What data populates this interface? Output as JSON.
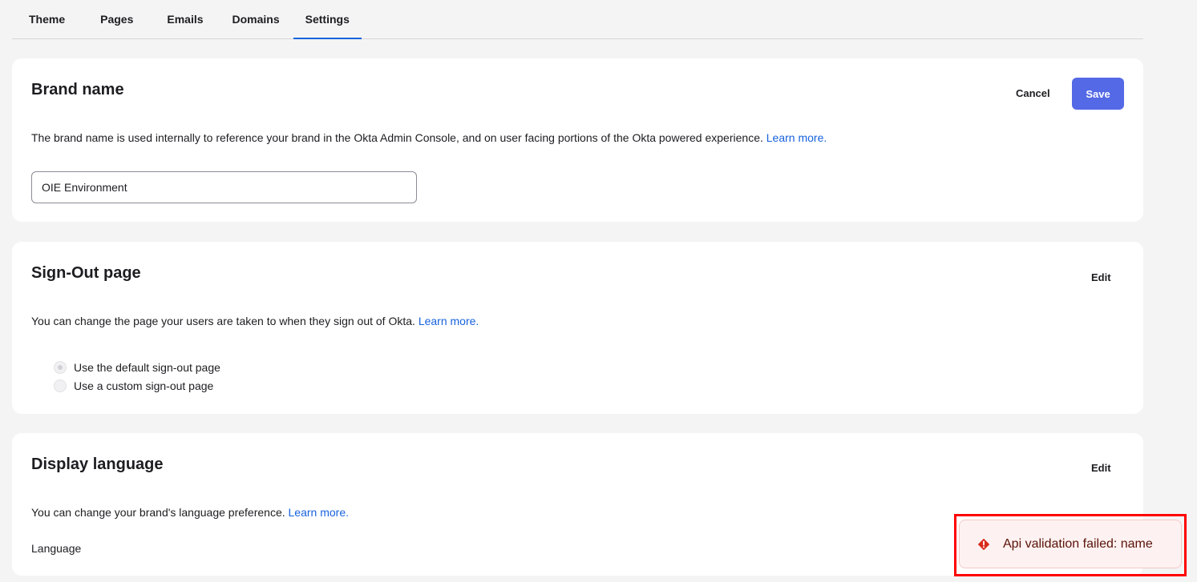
{
  "tabs": [
    {
      "label": "Theme",
      "active": false
    },
    {
      "label": "Pages",
      "active": false
    },
    {
      "label": "Emails",
      "active": false
    },
    {
      "label": "Domains",
      "active": false
    },
    {
      "label": "Settings",
      "active": true
    }
  ],
  "brand_name": {
    "title": "Brand name",
    "cancel_label": "Cancel",
    "save_label": "Save",
    "description": "The brand name is used internally to reference your brand in the Okta Admin Console, and on user facing portions of the Okta powered experience.",
    "learn_more": "Learn more.",
    "input_value": "OIE Environment"
  },
  "sign_out": {
    "title": "Sign-Out page",
    "edit_label": "Edit",
    "description": "You can change the page your users are taken to when they sign out of Okta.",
    "learn_more": "Learn more.",
    "options": [
      {
        "label": "Use the default sign-out page",
        "checked": true
      },
      {
        "label": "Use a custom sign-out page",
        "checked": false
      }
    ]
  },
  "display_language": {
    "title": "Display language",
    "edit_label": "Edit",
    "description": "You can change your brand's language preference.",
    "learn_more": "Learn more.",
    "language_label": "Language"
  },
  "toast": {
    "message": "Api validation failed: name",
    "icon": "error-diamond-icon",
    "color": "#d92b1a"
  },
  "colors": {
    "accent": "#1662dd",
    "save_button": "#5469e6"
  }
}
